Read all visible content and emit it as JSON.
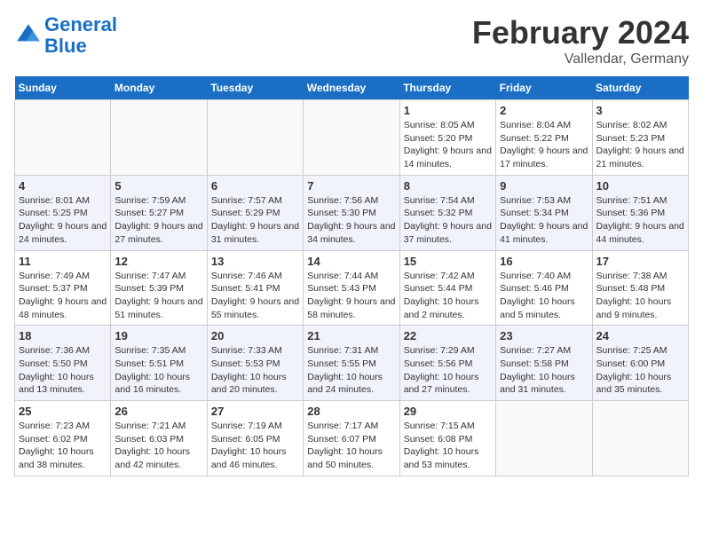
{
  "header": {
    "logo_line1": "General",
    "logo_line2": "Blue",
    "main_title": "February 2024",
    "subtitle": "Vallendar, Germany"
  },
  "weekdays": [
    "Sunday",
    "Monday",
    "Tuesday",
    "Wednesday",
    "Thursday",
    "Friday",
    "Saturday"
  ],
  "weeks": [
    [
      {
        "day": "",
        "sunrise": "",
        "sunset": "",
        "daylight": ""
      },
      {
        "day": "",
        "sunrise": "",
        "sunset": "",
        "daylight": ""
      },
      {
        "day": "",
        "sunrise": "",
        "sunset": "",
        "daylight": ""
      },
      {
        "day": "",
        "sunrise": "",
        "sunset": "",
        "daylight": ""
      },
      {
        "day": "1",
        "sunrise": "Sunrise: 8:05 AM",
        "sunset": "Sunset: 5:20 PM",
        "daylight": "Daylight: 9 hours and 14 minutes."
      },
      {
        "day": "2",
        "sunrise": "Sunrise: 8:04 AM",
        "sunset": "Sunset: 5:22 PM",
        "daylight": "Daylight: 9 hours and 17 minutes."
      },
      {
        "day": "3",
        "sunrise": "Sunrise: 8:02 AM",
        "sunset": "Sunset: 5:23 PM",
        "daylight": "Daylight: 9 hours and 21 minutes."
      }
    ],
    [
      {
        "day": "4",
        "sunrise": "Sunrise: 8:01 AM",
        "sunset": "Sunset: 5:25 PM",
        "daylight": "Daylight: 9 hours and 24 minutes."
      },
      {
        "day": "5",
        "sunrise": "Sunrise: 7:59 AM",
        "sunset": "Sunset: 5:27 PM",
        "daylight": "Daylight: 9 hours and 27 minutes."
      },
      {
        "day": "6",
        "sunrise": "Sunrise: 7:57 AM",
        "sunset": "Sunset: 5:29 PM",
        "daylight": "Daylight: 9 hours and 31 minutes."
      },
      {
        "day": "7",
        "sunrise": "Sunrise: 7:56 AM",
        "sunset": "Sunset: 5:30 PM",
        "daylight": "Daylight: 9 hours and 34 minutes."
      },
      {
        "day": "8",
        "sunrise": "Sunrise: 7:54 AM",
        "sunset": "Sunset: 5:32 PM",
        "daylight": "Daylight: 9 hours and 37 minutes."
      },
      {
        "day": "9",
        "sunrise": "Sunrise: 7:53 AM",
        "sunset": "Sunset: 5:34 PM",
        "daylight": "Daylight: 9 hours and 41 minutes."
      },
      {
        "day": "10",
        "sunrise": "Sunrise: 7:51 AM",
        "sunset": "Sunset: 5:36 PM",
        "daylight": "Daylight: 9 hours and 44 minutes."
      }
    ],
    [
      {
        "day": "11",
        "sunrise": "Sunrise: 7:49 AM",
        "sunset": "Sunset: 5:37 PM",
        "daylight": "Daylight: 9 hours and 48 minutes."
      },
      {
        "day": "12",
        "sunrise": "Sunrise: 7:47 AM",
        "sunset": "Sunset: 5:39 PM",
        "daylight": "Daylight: 9 hours and 51 minutes."
      },
      {
        "day": "13",
        "sunrise": "Sunrise: 7:46 AM",
        "sunset": "Sunset: 5:41 PM",
        "daylight": "Daylight: 9 hours and 55 minutes."
      },
      {
        "day": "14",
        "sunrise": "Sunrise: 7:44 AM",
        "sunset": "Sunset: 5:43 PM",
        "daylight": "Daylight: 9 hours and 58 minutes."
      },
      {
        "day": "15",
        "sunrise": "Sunrise: 7:42 AM",
        "sunset": "Sunset: 5:44 PM",
        "daylight": "Daylight: 10 hours and 2 minutes."
      },
      {
        "day": "16",
        "sunrise": "Sunrise: 7:40 AM",
        "sunset": "Sunset: 5:46 PM",
        "daylight": "Daylight: 10 hours and 5 minutes."
      },
      {
        "day": "17",
        "sunrise": "Sunrise: 7:38 AM",
        "sunset": "Sunset: 5:48 PM",
        "daylight": "Daylight: 10 hours and 9 minutes."
      }
    ],
    [
      {
        "day": "18",
        "sunrise": "Sunrise: 7:36 AM",
        "sunset": "Sunset: 5:50 PM",
        "daylight": "Daylight: 10 hours and 13 minutes."
      },
      {
        "day": "19",
        "sunrise": "Sunrise: 7:35 AM",
        "sunset": "Sunset: 5:51 PM",
        "daylight": "Daylight: 10 hours and 16 minutes."
      },
      {
        "day": "20",
        "sunrise": "Sunrise: 7:33 AM",
        "sunset": "Sunset: 5:53 PM",
        "daylight": "Daylight: 10 hours and 20 minutes."
      },
      {
        "day": "21",
        "sunrise": "Sunrise: 7:31 AM",
        "sunset": "Sunset: 5:55 PM",
        "daylight": "Daylight: 10 hours and 24 minutes."
      },
      {
        "day": "22",
        "sunrise": "Sunrise: 7:29 AM",
        "sunset": "Sunset: 5:56 PM",
        "daylight": "Daylight: 10 hours and 27 minutes."
      },
      {
        "day": "23",
        "sunrise": "Sunrise: 7:27 AM",
        "sunset": "Sunset: 5:58 PM",
        "daylight": "Daylight: 10 hours and 31 minutes."
      },
      {
        "day": "24",
        "sunrise": "Sunrise: 7:25 AM",
        "sunset": "Sunset: 6:00 PM",
        "daylight": "Daylight: 10 hours and 35 minutes."
      }
    ],
    [
      {
        "day": "25",
        "sunrise": "Sunrise: 7:23 AM",
        "sunset": "Sunset: 6:02 PM",
        "daylight": "Daylight: 10 hours and 38 minutes."
      },
      {
        "day": "26",
        "sunrise": "Sunrise: 7:21 AM",
        "sunset": "Sunset: 6:03 PM",
        "daylight": "Daylight: 10 hours and 42 minutes."
      },
      {
        "day": "27",
        "sunrise": "Sunrise: 7:19 AM",
        "sunset": "Sunset: 6:05 PM",
        "daylight": "Daylight: 10 hours and 46 minutes."
      },
      {
        "day": "28",
        "sunrise": "Sunrise: 7:17 AM",
        "sunset": "Sunset: 6:07 PM",
        "daylight": "Daylight: 10 hours and 50 minutes."
      },
      {
        "day": "29",
        "sunrise": "Sunrise: 7:15 AM",
        "sunset": "Sunset: 6:08 PM",
        "daylight": "Daylight: 10 hours and 53 minutes."
      },
      {
        "day": "",
        "sunrise": "",
        "sunset": "",
        "daylight": ""
      },
      {
        "day": "",
        "sunrise": "",
        "sunset": "",
        "daylight": ""
      }
    ]
  ]
}
